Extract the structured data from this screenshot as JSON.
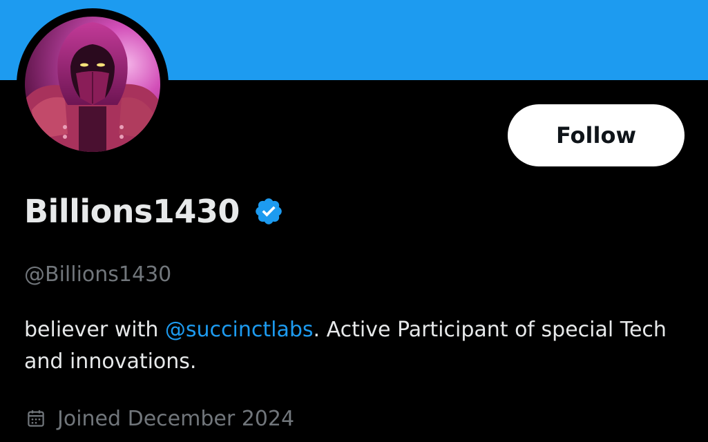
{
  "colors": {
    "banner": "#1d9bf0",
    "background": "#000000",
    "primary_text": "#e7e9ea",
    "secondary_text": "#71767b",
    "link": "#1d9bf0",
    "follow_button_bg": "#ffffff",
    "follow_button_text": "#0f1419",
    "verified_badge": "#1d9bf0"
  },
  "profile": {
    "avatar_icon": "hooded-ninja-avatar",
    "follow_label": "Follow",
    "display_name": "Billions1430",
    "verified_icon": "verified-badge-icon",
    "handle": "@Billions1430",
    "bio": {
      "before_mention": "believer with ",
      "mention": "@succinctlabs",
      "after_mention": ". Active Participant of special Tech and innovations."
    },
    "joined": {
      "icon": "calendar-icon",
      "text": "Joined December 2024"
    }
  }
}
